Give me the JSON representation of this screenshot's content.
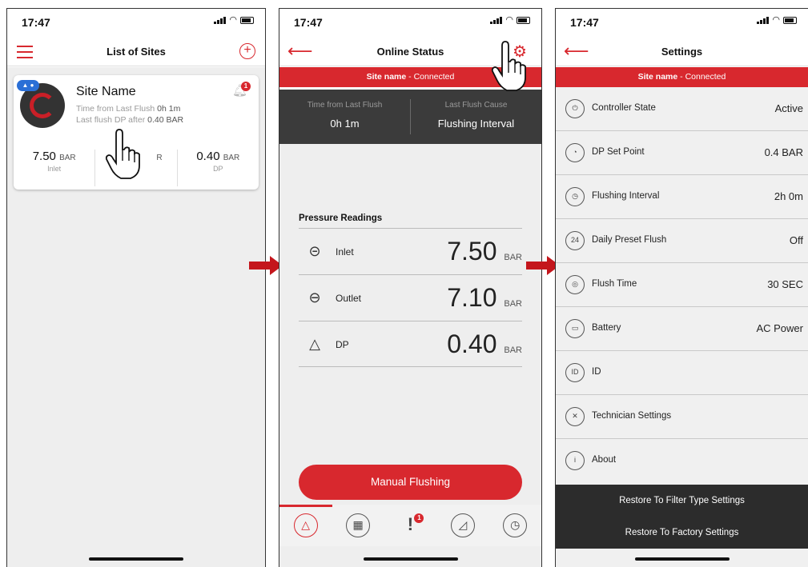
{
  "status_time": "17:47",
  "accent_color": "#d8282e",
  "screen1": {
    "title": "List of Sites",
    "site": {
      "name": "Site Name",
      "time_label": "Time from Last Flush",
      "time_value": "0h 1m",
      "dp_label": "Last flush DP after",
      "dp_value": "0.40 BAR",
      "notifications": "1",
      "stats": [
        {
          "value": "7.50",
          "unit": "BAR",
          "label": "Inlet"
        },
        {
          "value": "",
          "unit": "R",
          "label": ""
        },
        {
          "value": "0.40",
          "unit": "BAR",
          "label": "DP"
        }
      ]
    }
  },
  "screen2": {
    "title": "Online Status",
    "connection": {
      "site": "Site name",
      "status": "- Connected"
    },
    "last_flush": {
      "time_label": "Time from Last Flush",
      "time_value": "0h 1m",
      "cause_label": "Last Flush Cause",
      "cause_value": "Flushing Interval"
    },
    "pressure_title": "Pressure Readings",
    "readings": [
      {
        "name": "Inlet",
        "value": "7.50",
        "unit": "BAR",
        "icon": "inlet-icon"
      },
      {
        "name": "Outlet",
        "value": "7.10",
        "unit": "BAR",
        "icon": "outlet-icon"
      },
      {
        "name": "DP",
        "value": "0.40",
        "unit": "BAR",
        "icon": "delta-icon"
      }
    ],
    "manual_button": "Manual Flushing",
    "alerts_badge": "1"
  },
  "screen3": {
    "title": "Settings",
    "connection": {
      "site": "Site name",
      "status": "- Connected"
    },
    "items": [
      {
        "label": "Controller State",
        "value": "Active"
      },
      {
        "label": "DP Set Point",
        "value": "0.4 BAR"
      },
      {
        "label": "Flushing Interval",
        "value": "2h 0m"
      },
      {
        "label": "Daily Preset Flush",
        "value": "Off"
      },
      {
        "label": "Flush Time",
        "value": "30 SEC"
      },
      {
        "label": "Battery",
        "value": "AC Power"
      },
      {
        "label": "ID",
        "value": ""
      },
      {
        "label": "Technician Settings",
        "value": ""
      },
      {
        "label": "About",
        "value": ""
      }
    ],
    "restore_filter": "Restore To Filter Type Settings",
    "restore_factory": "Restore To Factory Settings"
  }
}
